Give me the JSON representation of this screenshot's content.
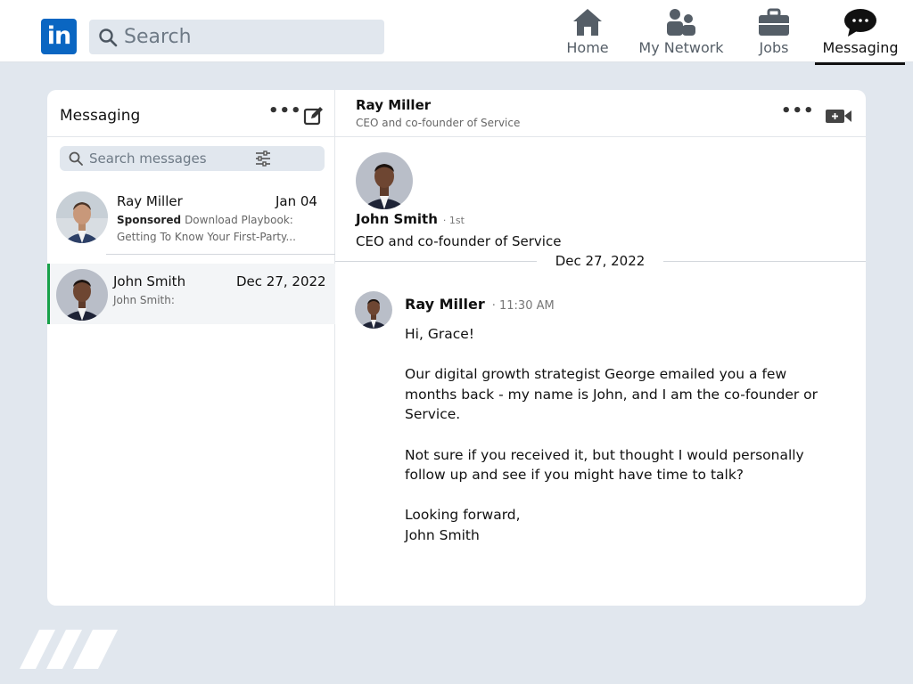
{
  "topbar": {
    "logo_text": "in",
    "search_placeholder": "Search",
    "nav": [
      {
        "label": "Home",
        "icon": "home-icon"
      },
      {
        "label": "My Network",
        "icon": "people-icon"
      },
      {
        "label": "Jobs",
        "icon": "briefcase-icon"
      },
      {
        "label": "Messaging",
        "icon": "chat-bubble-icon",
        "active": true
      }
    ]
  },
  "sidebar": {
    "title": "Messaging",
    "search_placeholder": "Search messages",
    "conversations": [
      {
        "name": "Ray Miller",
        "date": "Jan 04",
        "sponsored_label": "Sponsored",
        "snippet": "Download Playbook: Getting To Know Your First-Party..."
      },
      {
        "name": "John Smith",
        "date": "Dec 27, 2022",
        "snippet": "John Smith:",
        "active": true
      }
    ]
  },
  "thread": {
    "header_name": "Ray Miller",
    "header_subtitle": "CEO and co-founder of Service",
    "profile": {
      "name": "John Smith",
      "degree": "· 1st",
      "title": "CEO and co-founder of Service"
    },
    "date_divider": "Dec 27, 2022",
    "message": {
      "sender": "Ray Miller",
      "time": "· 11:30 AM",
      "paragraphs": [
        "Hi, Grace!",
        "Our digital growth strategist George emailed you a few months back - my name is John, and I am the co-founder or Service.",
        "Not sure if you received it, but thought I would personally follow up and see if you might have time to talk?",
        "Looking forward,\nJohn Smith"
      ]
    }
  },
  "colors": {
    "brand_blue": "#0a66c2",
    "page_bg": "#e1e7ee",
    "active_bar": "#19a14a"
  }
}
